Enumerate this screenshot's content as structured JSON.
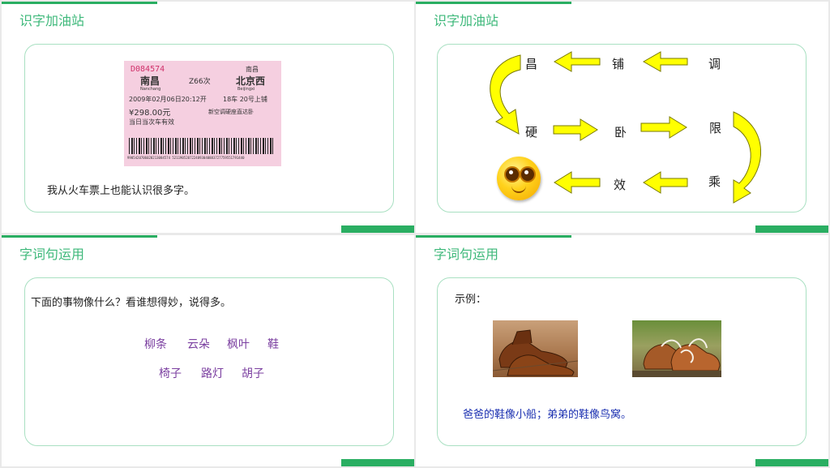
{
  "slide1": {
    "title": "识字加油站",
    "ticket": {
      "serial": "D084574",
      "from": "南昌",
      "from_pinyin": "Nanchang",
      "train": "Z66次",
      "to": "北京西",
      "to_pinyin": "Beijingxi",
      "station_tag": "南昌",
      "date_line": "2009年02月06日20:12开",
      "seat_line": "18车 20号上铺",
      "price": "¥298.00元",
      "class_line": "新空调硬座直达卧",
      "valid_line": "当日当次车有效",
      "barcode_text": "9905420706020213084574 5211905207224893040883727759551791440"
    },
    "caption": "我从火车票上也能认识很多字。"
  },
  "slide2": {
    "title": "识字加油站",
    "chars": [
      "昌",
      "铺",
      "调",
      "硬",
      "卧",
      "限",
      "效",
      "乘"
    ]
  },
  "slide3": {
    "title": "字词句运用",
    "prompt": "下面的事物像什么？看谁想得妙，说得多。",
    "row1": [
      "柳条",
      "云朵",
      "枫叶",
      "鞋"
    ],
    "row2": [
      "椅子",
      "路灯",
      "胡子"
    ]
  },
  "slide4": {
    "title": "字词句运用",
    "example_label": "示例：",
    "sentence": "爸爸的鞋像小船；弟弟的鞋像鸟窝。"
  },
  "colors": {
    "accent": "#2aae62",
    "title": "#3db87a",
    "arrow": "#ffff00",
    "word": "#7b3fa0",
    "sentence": "#1a2fb0"
  }
}
